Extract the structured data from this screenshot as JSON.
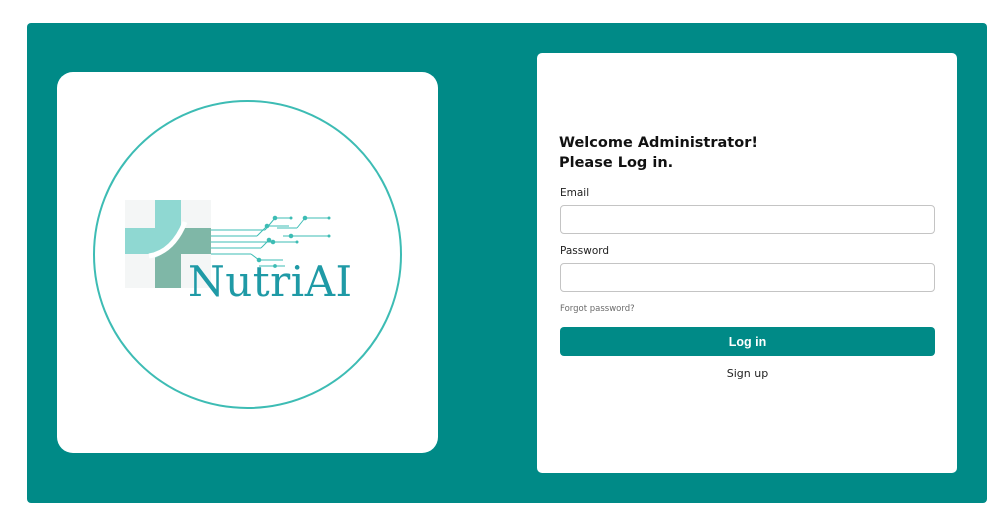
{
  "logo": {
    "brand_name": "NutriAI",
    "colors": {
      "cross_light": "#8fd8d2",
      "cross_dark": "#7fb7a7",
      "text": "#1f9aa6",
      "circuit": "#3dbcb4"
    }
  },
  "login": {
    "heading_line1": "Welcome Administrator!",
    "heading_line2": "Please Log in.",
    "email_label": "Email",
    "email_value": "",
    "password_label": "Password",
    "password_value": "",
    "forgot_label": "Forgot password?",
    "login_button": "Log in",
    "signup_label": "Sign up"
  },
  "colors": {
    "accent": "#008a87",
    "background": "#ffffff"
  }
}
